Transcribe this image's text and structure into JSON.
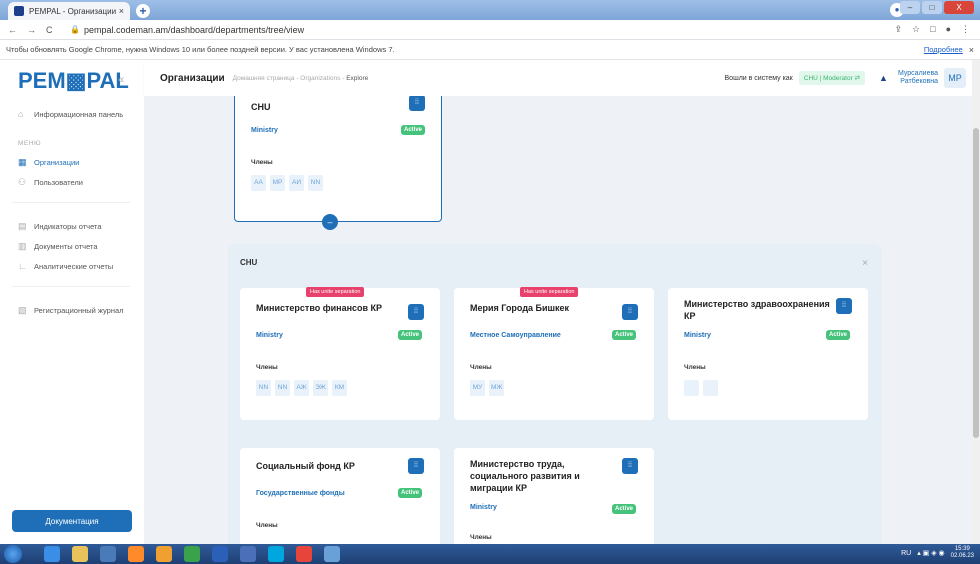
{
  "browser": {
    "tab_title": "PEMPAL - Организации",
    "tab_close": "×",
    "new_tab": "+",
    "url": "pempal.codeman.am/dashboard/departments/tree/view",
    "nav_back": "←",
    "nav_forward": "→",
    "nav_reload": "C",
    "profile_initial": "●",
    "win_min": "–",
    "win_max": "□",
    "win_close": "X",
    "tools": [
      "⇪",
      "☆",
      "□",
      "●",
      "⋮"
    ]
  },
  "infobar": {
    "message": "Чтобы обновлять Google Chrome, нужна Windows 10 или более поздней версии. У вас установлена Windows 7.",
    "more": "Подробнее",
    "close": "×"
  },
  "sidebar": {
    "logo": "PEM▩PAL",
    "collapse": "«",
    "items_top": [
      {
        "label": "Информационная панель",
        "icon": "home-icon"
      }
    ],
    "section_label": "МЕНЮ",
    "items_menu": [
      {
        "label": "Организации",
        "icon": "building-icon",
        "active": true
      },
      {
        "label": "Пользователи",
        "icon": "users-icon",
        "active": false
      }
    ],
    "items_reports": [
      {
        "label": "Индикаторы отчета",
        "icon": "document-icon"
      },
      {
        "label": "Документы отчета",
        "icon": "file-icon"
      },
      {
        "label": "Аналитические отчеты",
        "icon": "chart-icon"
      }
    ],
    "items_log": [
      {
        "label": "Регистрационный журнал",
        "icon": "log-icon"
      }
    ],
    "doc_button": "Документация"
  },
  "header": {
    "title": "Организации",
    "breadcrumb_home": "Домашняя страница",
    "breadcrumb_sep": "-",
    "breadcrumb_org": "Organizations",
    "breadcrumb_current": "Explore",
    "login_label": "Вошли в систему как",
    "role": "CHU | Moderator",
    "user_first": "Мурсалиева",
    "user_last": "Ратбековна",
    "avatar": "MP"
  },
  "root_card": {
    "name": "CHU",
    "type": "Ministry",
    "status": "Active",
    "members_label": "Члены",
    "members": [
      "AA",
      "MP",
      "АИ",
      "NN"
    ],
    "toggle": "–"
  },
  "panel": {
    "title": "CHU",
    "close": "×",
    "cards": [
      {
        "name": "Министерство финансов КР",
        "type": "Ministry",
        "status": "Active",
        "badge": "Has unite separation",
        "members_label": "Члены",
        "members": [
          "NN",
          "NN",
          "АЖ",
          "ЭЖ",
          "КМ"
        ]
      },
      {
        "name": "Мерия Города Бишкек",
        "type": "Местное Самоуправление",
        "status": "Active",
        "badge": "Has unite separation",
        "members_label": "Члены",
        "members": [
          "МУ",
          "МЖ"
        ]
      },
      {
        "name": "Министерство здравоохранения КР",
        "type": "Ministry",
        "status": "Active",
        "badge": "",
        "members_label": "Члены",
        "members": [
          "",
          ""
        ]
      },
      {
        "name": "Социальный фонд КР",
        "type": "Государственные фонды",
        "status": "Active",
        "badge": "",
        "members_label": "Члены",
        "members": []
      },
      {
        "name": "Министерство труда, социального развития и миграции КР",
        "type": "Ministry",
        "status": "Active",
        "badge": "",
        "members_label": "Члены",
        "members": []
      }
    ]
  },
  "taskbar": {
    "lang": "RU",
    "time": "15:39",
    "date": "02.06.23"
  }
}
